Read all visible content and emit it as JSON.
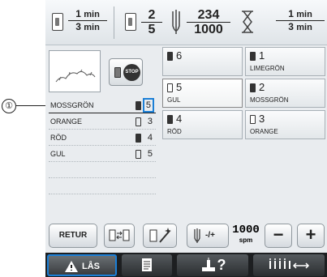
{
  "callout": {
    "label": "①"
  },
  "topbar": {
    "time_total": {
      "num": "1",
      "num_unit": "min",
      "den": "3",
      "den_unit": "min"
    },
    "color_count": {
      "num": "2",
      "den": "5"
    },
    "stitches": {
      "num": "234",
      "den": "1000"
    },
    "time_remaining": {
      "num": "1",
      "num_unit": "min",
      "den": "3",
      "den_unit": "min"
    },
    "icons": [
      "spool-clock-icon",
      "spool-icon",
      "needle-icon",
      "hourglass-icon"
    ]
  },
  "stop_button": {
    "label": "STOP"
  },
  "thread_list": [
    {
      "name": "MOSSGRÖN",
      "number": "5",
      "spool": "dark"
    },
    {
      "name": "ORANGE",
      "number": "3",
      "spool": "light"
    },
    {
      "name": "RÖD",
      "number": "4",
      "spool": "dark"
    },
    {
      "name": "GUL",
      "number": "5",
      "spool": "light"
    }
  ],
  "color_grid": [
    {
      "number": "6",
      "name": "",
      "spool": "dark"
    },
    {
      "number": "1",
      "name": "LIMEGRÖN",
      "spool": "dark"
    },
    {
      "number": "5",
      "name": "GUL",
      "spool": "light"
    },
    {
      "number": "2",
      "name": "MOSSGRÖN",
      "spool": "dark"
    },
    {
      "number": "4",
      "name": "RÖD",
      "spool": "dark"
    },
    {
      "number": "3",
      "name": "ORANGE",
      "spool": "light"
    }
  ],
  "buttons": {
    "retur": "RETUR",
    "speed_adjust": "-/+",
    "speed_value": "1000",
    "speed_unit": "spm",
    "minus": "−",
    "plus": "+"
  },
  "nav": {
    "lock_label": "LÅS",
    "help_label": "?",
    "accent": "#1b7fd6"
  }
}
